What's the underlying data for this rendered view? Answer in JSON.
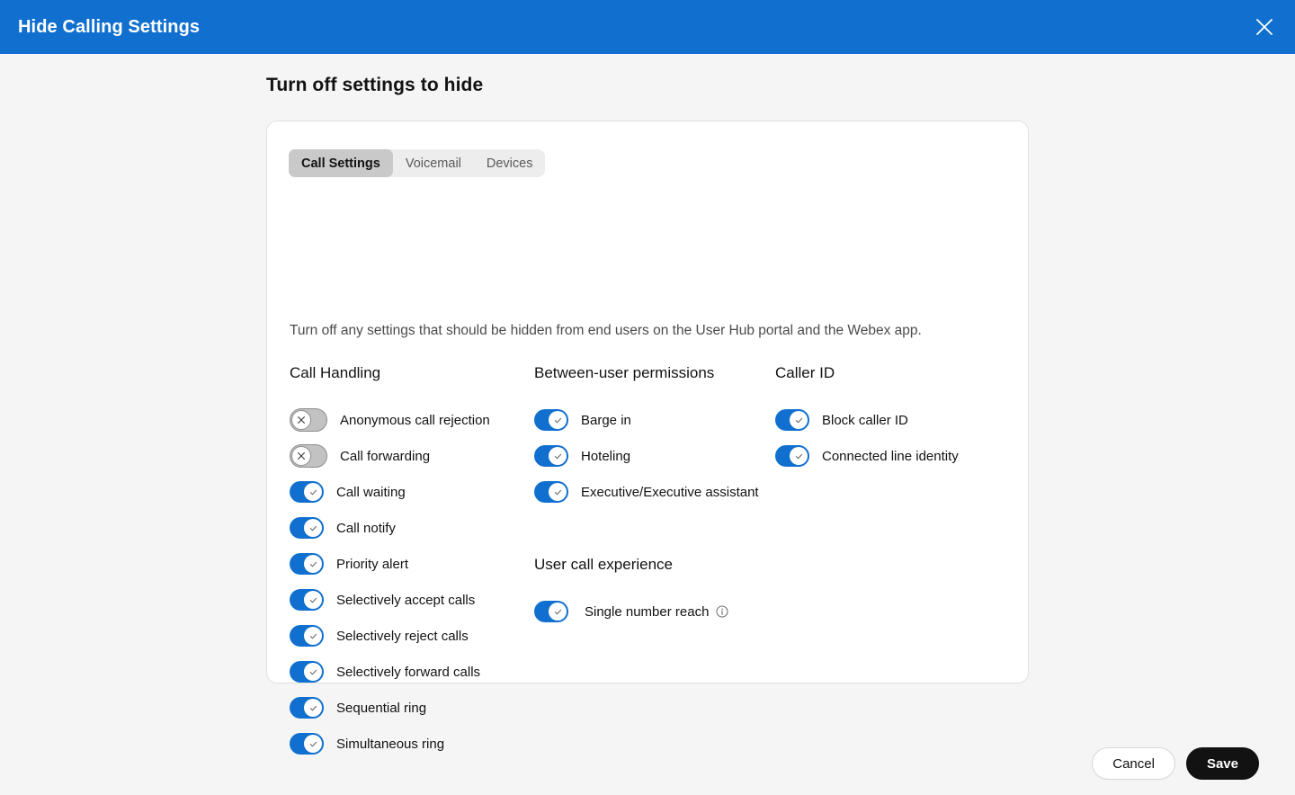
{
  "titlebar": {
    "title": "Hide Calling Settings",
    "close_icon": "close-icon"
  },
  "page": {
    "heading": "Turn off settings to hide"
  },
  "card": {
    "tabs": [
      {
        "label": "Call Settings",
        "active": true
      },
      {
        "label": "Voicemail",
        "active": false
      },
      {
        "label": "Devices",
        "active": false
      }
    ],
    "description": "Turn off any settings that should be hidden from end users on the User Hub portal and the Webex app.",
    "groups": [
      {
        "id": "call-handling",
        "title": "Call Handling",
        "items": [
          {
            "label": "Anonymous call rejection",
            "state": "off"
          },
          {
            "label": "Call forwarding",
            "state": "off"
          },
          {
            "label": "Call waiting",
            "state": "on"
          },
          {
            "label": "Call notify",
            "state": "on"
          },
          {
            "label": "Priority alert",
            "state": "on"
          },
          {
            "label": "Selectively accept calls",
            "state": "on"
          },
          {
            "label": "Selectively reject calls",
            "state": "on"
          },
          {
            "label": "Selectively forward calls",
            "state": "on"
          },
          {
            "label": "Sequential ring",
            "state": "on"
          },
          {
            "label": "Simultaneous ring",
            "state": "on"
          }
        ]
      },
      {
        "id": "between-user-permissions",
        "title": "Between-user permissions",
        "items": [
          {
            "label": "Barge in",
            "state": "on"
          },
          {
            "label": "Hoteling",
            "state": "on"
          },
          {
            "label": "Executive/Executive assistant",
            "state": "on"
          }
        ]
      },
      {
        "id": "caller-id",
        "title": "Caller ID",
        "items": [
          {
            "label": "Block caller ID",
            "state": "on"
          },
          {
            "label": "Connected line identity",
            "state": "on"
          }
        ]
      },
      {
        "id": "user-call-experience",
        "title": "User call experience",
        "items": [
          {
            "label": "Single number reach",
            "state": "on",
            "info_icon": "info-icon"
          }
        ]
      }
    ]
  },
  "footer": {
    "cancel_label": "Cancel",
    "save_label": "Save"
  },
  "colors": {
    "header_blue": "#1170cf",
    "toggle_on_blue": "#1170cf",
    "toggle_off_gray": "#c2c2c2",
    "tab_active_gray": "#c9c9c9",
    "tabs_track_gray": "#ededed",
    "save_black": "#121212",
    "page_bg": "#f5f5f5"
  }
}
